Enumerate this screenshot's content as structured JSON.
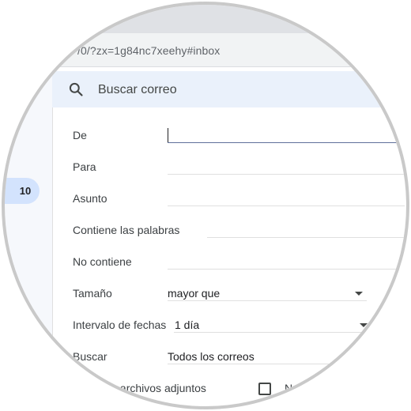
{
  "browser": {
    "url_fragment": "/0/?zx=1g84nc7xeehy#inbox"
  },
  "sidebar": {
    "badge_count": "10"
  },
  "search": {
    "placeholder": "Buscar correo"
  },
  "filter_form": {
    "from_label": "De",
    "to_label": "Para",
    "subject_label": "Asunto",
    "has_words_label": "Contiene las palabras",
    "doesnt_have_label": "No contiene",
    "size_label": "Tamaño",
    "size_value": "mayor que",
    "date_range_label": "Intervalo de fechas",
    "date_range_value": "1 día",
    "search_in_label": "Buscar",
    "search_in_value": "Todos los correos",
    "has_attachment_label": "Contiene archivos adjuntos",
    "exclude_chats_label_partial": "N"
  },
  "icons": {
    "search": "search-icon",
    "dropdown": "chevron-down-icon",
    "checkbox": "checkbox-icon"
  },
  "colors": {
    "search_bg": "#eaf1fb",
    "badge_bg": "#d3e3fd",
    "lens_ring": "#c9c9c9"
  }
}
